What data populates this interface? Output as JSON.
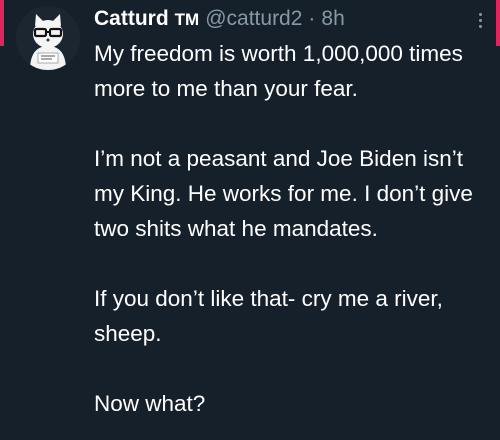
{
  "tweet": {
    "display_name": "Catturd",
    "badge": "TM",
    "handle": "@catturd2",
    "separator": "·",
    "time": "8h",
    "paragraphs": [
      "My freedom is worth 1,000,000 times more to me than your fear.",
      "I’m not a peasant and Joe Biden isn’t my King. He works for me. I don’t give two shits what he mandates.",
      "If you don’t like that- cry me a river, sheep.",
      "Now what?"
    ]
  },
  "colors": {
    "background": "#15202b",
    "text": "#ffffff",
    "muted": "#8899a6",
    "accent": "#e0245e"
  },
  "icons": {
    "avatar": "cat-with-glasses-avatar",
    "more": "more-options-icon"
  }
}
